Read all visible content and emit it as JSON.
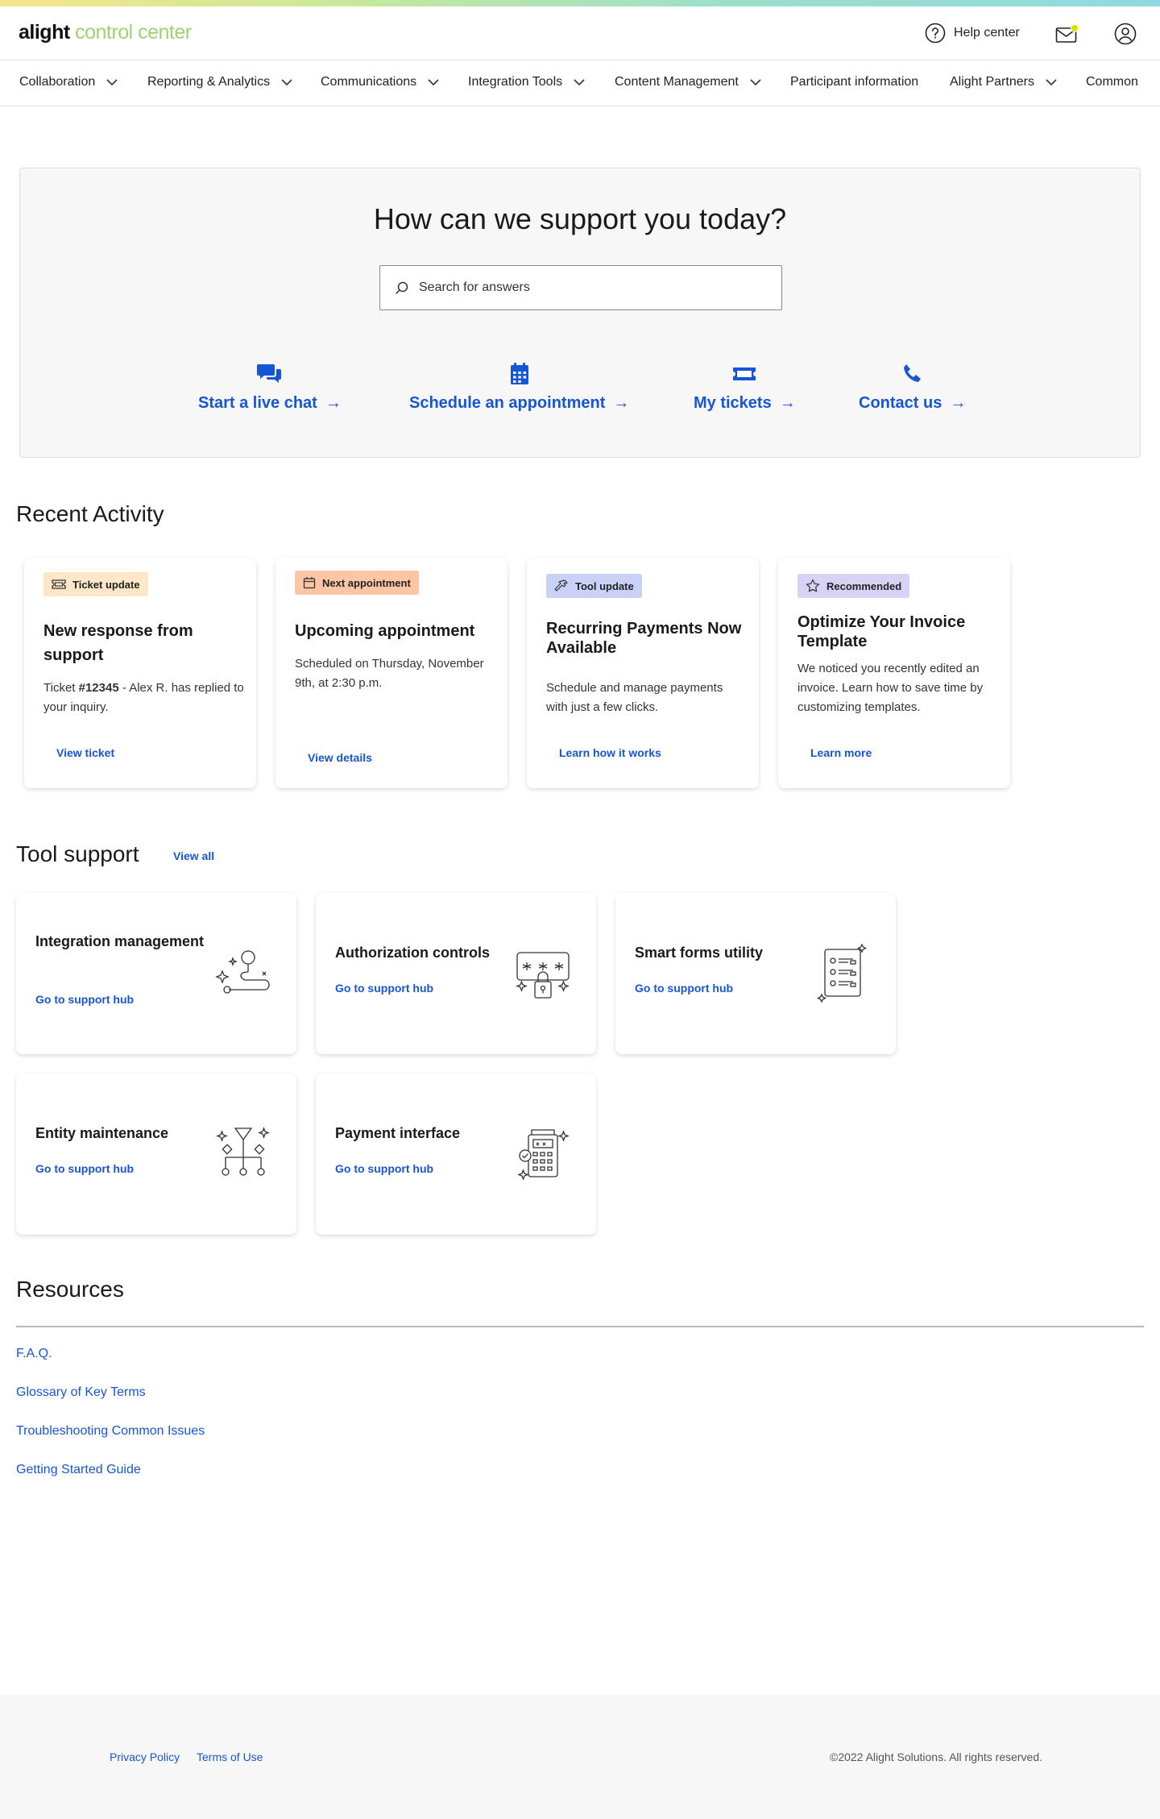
{
  "brand": {
    "part1": "alight",
    "part2": "control center"
  },
  "header": {
    "help_label": "Help center",
    "notification_color": "#d4e600"
  },
  "nav": {
    "items": [
      {
        "label": "Collaboration",
        "has_menu": true
      },
      {
        "label": "Reporting & Analytics",
        "has_menu": true
      },
      {
        "label": "Communications",
        "has_menu": true
      },
      {
        "label": "Integration Tools",
        "has_menu": true
      },
      {
        "label": "Content Management",
        "has_menu": true
      },
      {
        "label": "Participant information",
        "has_menu": false
      },
      {
        "label": "Alight Partners",
        "has_menu": true
      },
      {
        "label": "Common",
        "has_menu": false
      }
    ]
  },
  "hero": {
    "title": "How can we support you today?",
    "search_placeholder": "Search for answers",
    "actions": [
      {
        "label": "Start a live chat",
        "icon": "chat-bubbles-icon"
      },
      {
        "label": "Schedule an appointment",
        "icon": "calendar-icon"
      },
      {
        "label": "My tickets",
        "icon": "ticket-icon"
      },
      {
        "label": "Contact us",
        "icon": "phone-icon"
      }
    ]
  },
  "recent": {
    "title": "Recent Activity",
    "cards": [
      {
        "badge": "Ticket update",
        "badge_color": "#fde7c8",
        "badge_icon": "ticket-icon",
        "title": "New response from support",
        "body_prefix": "Ticket ",
        "body_ticket": "#12345",
        "body_suffix": " - Alex R. has replied to your inquiry.",
        "link": "View ticket"
      },
      {
        "badge": "Next appointment",
        "badge_color": "#fcc6a6",
        "badge_icon": "calendar-icon",
        "title": "Upcoming appointment",
        "body": "Scheduled on Thursday, November 9th, at 2:30 p.m.",
        "link": "View details"
      },
      {
        "badge": "Tool update",
        "badge_color": "#c9d1f7",
        "badge_icon": "hammer-icon",
        "title": "Recurring Payments Now Available",
        "body": "Schedule and manage payments with just a few clicks.",
        "link": "Learn how it works"
      },
      {
        "badge": "Recommended",
        "badge_color": "#d8d2f7",
        "badge_icon": "star-icon",
        "title": "Optimize Your Invoice Template",
        "body": "We noticed you recently edited an invoice. Learn how to save time by customizing templates.",
        "link": "Learn more"
      }
    ]
  },
  "tools": {
    "title": "Tool support",
    "view_all": "View all",
    "cards": [
      {
        "title": "Integration management",
        "link": "Go to support hub",
        "icon": "integration-path-icon"
      },
      {
        "title": "Authorization controls",
        "link": "Go to support hub",
        "icon": "password-lock-icon"
      },
      {
        "title": "Smart forms utility",
        "link": "Go to support hub",
        "icon": "form-checklist-icon"
      },
      {
        "title": "Entity maintenance",
        "link": "Go to support hub",
        "icon": "hierarchy-icon"
      },
      {
        "title": "Payment interface",
        "link": "Go to support hub",
        "icon": "calculator-icon"
      }
    ]
  },
  "resources": {
    "title": "Resources",
    "links": [
      "F.A.Q.",
      "Glossary of Key Terms",
      "Troubleshooting Common Issues",
      "Getting Started Guide"
    ]
  },
  "footer": {
    "privacy": "Privacy Policy",
    "terms": "Terms of Use",
    "copyright": "©2022 Alight Solutions. All rights reserved."
  }
}
